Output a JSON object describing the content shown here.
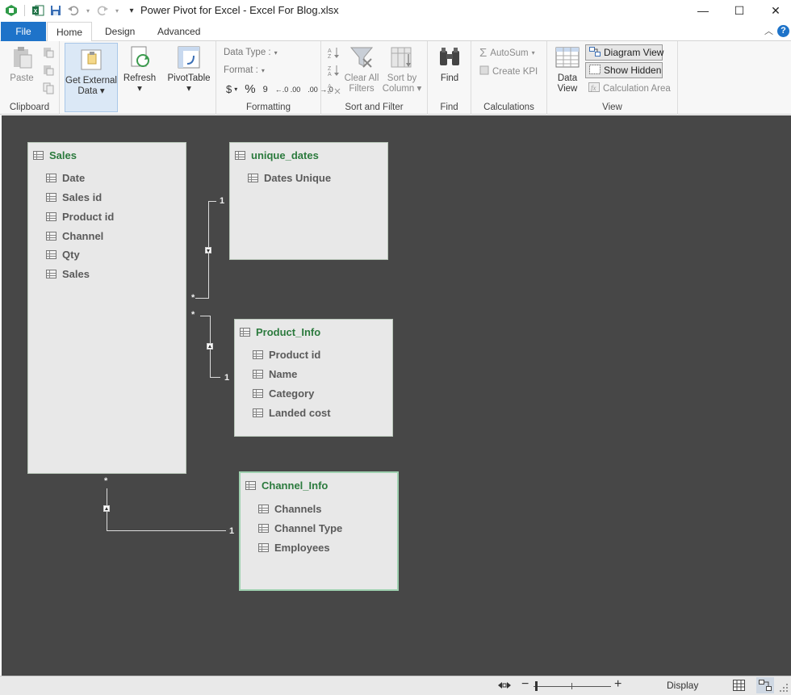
{
  "window": {
    "title": "Power Pivot for Excel - Excel For Blog.xlsx",
    "minimize_glyph": "—",
    "maximize_glyph": "☐",
    "close_glyph": "✕"
  },
  "quick_access": {
    "icons": [
      "powerpivot-icon",
      "excel-icon",
      "save-icon",
      "undo-icon",
      "redo-icon",
      "customize-icon"
    ]
  },
  "tabs": [
    {
      "label": "File"
    },
    {
      "label": "Home"
    },
    {
      "label": "Design"
    },
    {
      "label": "Advanced"
    }
  ],
  "help_glyph": "?",
  "ribbon": {
    "clipboard": {
      "label": "Clipboard",
      "paste": "Paste"
    },
    "get_external": {
      "line1": "Get External",
      "line2": "Data ▾"
    },
    "refresh": {
      "line1": "Refresh",
      "line2": "▾"
    },
    "pivottable": {
      "line1": "PivotTable",
      "line2": "▾"
    },
    "formatting": {
      "label": "Formatting",
      "data_type": "Data Type :",
      "format": "Format :",
      "currency": "$",
      "percent": "%",
      "comma": "9",
      "inc_dec": "←.0 .00",
      "dec_dec": ".00 →.0"
    },
    "sort_filter": {
      "label": "Sort and Filter",
      "clear_all_line1": "Clear All",
      "clear_all_line2": "Filters",
      "sort_by_line1": "Sort by",
      "sort_by_line2": "Column ▾"
    },
    "find": {
      "label": "Find",
      "button": "Find"
    },
    "calculations": {
      "label": "Calculations",
      "autosum": "AutoSum",
      "create_kpi": "Create KPI"
    },
    "view": {
      "label": "View",
      "data_view_line1": "Data",
      "data_view_line2": "View",
      "diagram_view": "Diagram View",
      "show_hidden": "Show Hidden",
      "calc_area": "Calculation Area"
    }
  },
  "diagram": {
    "tables": [
      {
        "name": "Sales",
        "fields": [
          "Date",
          "Sales id",
          "Product id",
          "Channel",
          "Qty",
          "Sales"
        ]
      },
      {
        "name": "unique_dates",
        "fields": [
          "Dates Unique"
        ]
      },
      {
        "name": "Product_Info",
        "fields": [
          "Product id",
          "Name",
          "Category",
          "Landed cost"
        ]
      },
      {
        "name": "Channel_Info",
        "fields": [
          "Channels",
          "Channel Type",
          "Employees"
        ]
      }
    ],
    "relationships": [
      {
        "many": "*",
        "one": "1"
      },
      {
        "many": "*",
        "one": "1"
      },
      {
        "many": "*",
        "one": "1"
      }
    ]
  },
  "statusbar": {
    "display": "Display",
    "zoom_minus": "−",
    "zoom_plus": "+"
  },
  "colors": {
    "accent": "#1e73c9",
    "canvas": "#474747",
    "table_title": "#2b7a3d"
  }
}
